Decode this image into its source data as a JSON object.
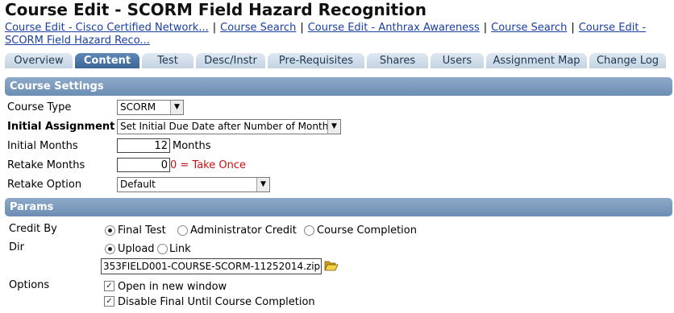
{
  "page": {
    "title": "Course Edit - SCORM Field Hazard Recognition"
  },
  "breadcrumbs": [
    "Course Edit - Cisco Certified Network...",
    "Course Search",
    "Course Edit - Anthrax Awareness",
    "Course Search",
    "Course Edit - SCORM Field Hazard Reco..."
  ],
  "breadcrumb_sep": "|",
  "tabs": [
    {
      "label": "Overview",
      "active": false
    },
    {
      "label": "Content",
      "active": true
    },
    {
      "label": "Test",
      "active": false
    },
    {
      "label": "Desc/Instr",
      "active": false
    },
    {
      "label": "Pre-Requisites",
      "active": false
    },
    {
      "label": "Shares",
      "active": false
    },
    {
      "label": "Users",
      "active": false
    },
    {
      "label": "Assignment Map",
      "active": false
    },
    {
      "label": "Change Log",
      "active": false
    }
  ],
  "course_settings": {
    "header": "Course Settings",
    "course_type_label": "Course Type",
    "course_type_value": "SCORM",
    "initial_assignment_label": "Initial Assignment",
    "initial_assignment_value": "Set Initial Due Date after Number of Months",
    "initial_months_label": "Initial Months",
    "initial_months_value": "12",
    "months_unit": "Months",
    "retake_months_label": "Retake Months",
    "retake_months_value": "0",
    "retake_hint": "0 = Take Once",
    "retake_option_label": "Retake Option",
    "retake_option_value": "Default"
  },
  "params": {
    "header": "Params",
    "credit_by_label": "Credit By",
    "credit_options": [
      "Final Test",
      "Administrator Credit",
      "Course Completion"
    ],
    "credit_selected": "Final Test",
    "dir_label": "Dir",
    "dir_options": [
      "Upload",
      "Link"
    ],
    "dir_selected": "Upload",
    "file_name": "353FIELD001-COURSE-SCORM-11252014.zip",
    "options_label": "Options",
    "option_new_window": "Open in new window",
    "option_new_window_checked": true,
    "option_disable_final": "Disable Final Until Course Completion",
    "option_disable_final_checked": true
  },
  "colors": {
    "link": "#1a3ea1",
    "section_bar": "#7b9bbf",
    "tab_active": "#4a74a6",
    "hint_red": "#cc1111"
  },
  "icons": {
    "browse": "folder-open-icon"
  }
}
